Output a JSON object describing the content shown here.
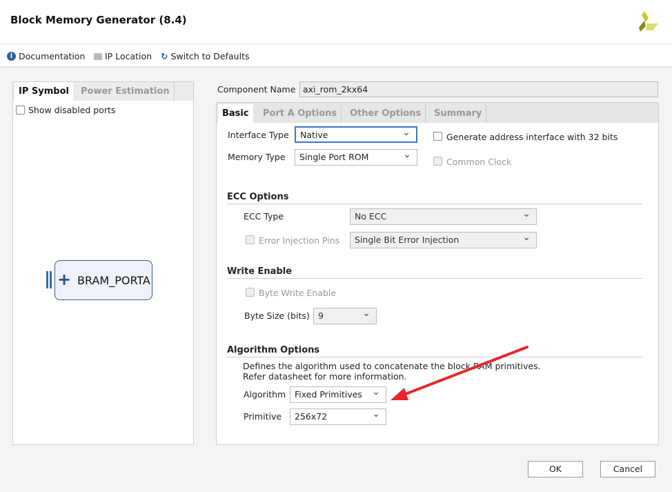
{
  "window": {
    "title": "Block Memory Generator (8.4)",
    "logo": "xilinx-logo"
  },
  "toolbar": {
    "documentation": "Documentation",
    "ip_location": "IP Location",
    "switch_defaults": "Switch to Defaults"
  },
  "left": {
    "tabs": [
      "IP Symbol",
      "Power Estimation"
    ],
    "show_disabled_ports": "Show disabled ports",
    "symbol_port": "BRAM_PORTA"
  },
  "component": {
    "label": "Component Name",
    "value": "axi_rom_2kx64"
  },
  "tabs": [
    "Basic",
    "Port A Options",
    "Other Options",
    "Summary"
  ],
  "basic": {
    "interface_type_label": "Interface Type",
    "interface_type": "Native",
    "memory_type_label": "Memory Type",
    "memory_type": "Single Port ROM",
    "gen_addr_32": "Generate address interface with 32 bits",
    "common_clock": "Common Clock",
    "ecc_title": "ECC Options",
    "ecc_type_label": "ECC Type",
    "ecc_type": "No ECC",
    "error_injection_label": "Error Injection Pins",
    "error_injection": "Single Bit Error Injection",
    "we_title": "Write Enable",
    "byte_write_enable": "Byte Write Enable",
    "byte_size_label": "Byte Size (bits)",
    "byte_size": "9",
    "algo_title": "Algorithm Options",
    "algo_desc1": "Defines the algorithm used to concatenate the block RAM primitives.",
    "algo_desc2": "Refer datasheet for more information.",
    "algorithm_label": "Algorithm",
    "algorithm": "Fixed Primitives",
    "primitive_label": "Primitive",
    "primitive": "256x72"
  },
  "buttons": {
    "ok": "OK",
    "cancel": "Cancel"
  },
  "annotation": {
    "arrow_color": "#e8262b"
  }
}
